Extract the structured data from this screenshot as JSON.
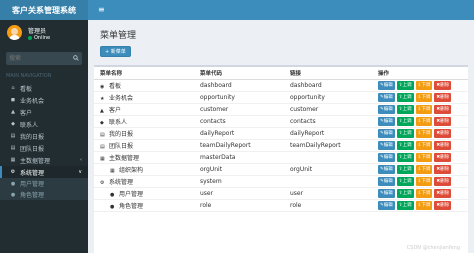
{
  "app": {
    "title": "客户关系管理系统",
    "menu_toggle": "≡"
  },
  "user": {
    "name": "管理员",
    "status": "Online"
  },
  "search": {
    "placeholder": "搜索"
  },
  "sidebar": {
    "header": "MAIN NAVIGATION",
    "items": [
      {
        "icon": "⌂",
        "label": "看板"
      },
      {
        "icon": "◼",
        "label": "业务机会"
      },
      {
        "icon": "▲",
        "label": "客户"
      },
      {
        "icon": "◆",
        "label": "联系人"
      },
      {
        "icon": "▤",
        "label": "我的日报"
      },
      {
        "icon": "▤",
        "label": "团队日报"
      },
      {
        "icon": "▦",
        "label": "主数据管理",
        "caret": "‹"
      },
      {
        "icon": "⚙",
        "label": "系统管理",
        "caret": "∨"
      }
    ],
    "subitems": [
      {
        "icon": "●",
        "label": "用户管理"
      },
      {
        "icon": "●",
        "label": "角色管理"
      }
    ]
  },
  "page": {
    "title": "菜单管理",
    "add_button": "+ 新菜单"
  },
  "table": {
    "headers": [
      "菜单名称",
      "菜单代码",
      "链接",
      "操作"
    ],
    "rows": [
      {
        "icon": "◉",
        "name": "看板",
        "code": "dashboard",
        "link": "dashboard"
      },
      {
        "icon": "★",
        "name": "业务机会",
        "code": "opportunity",
        "link": "opportunity"
      },
      {
        "icon": "▲",
        "name": "客户",
        "code": "customer",
        "link": "customer"
      },
      {
        "icon": "◆",
        "name": "联系人",
        "code": "contacts",
        "link": "contacts"
      },
      {
        "icon": "▤",
        "name": "我的日报",
        "code": "dailyReport",
        "link": "dailyReport"
      },
      {
        "icon": "▤",
        "name": "团队日报",
        "code": "teamDailyReport",
        "link": "teamDailyReport"
      },
      {
        "icon": "▦",
        "name": "主数据管理",
        "code": "masterData",
        "link": ""
      },
      {
        "icon": "▦",
        "name": "组织架构",
        "code": "orgUnit",
        "link": "orgUnit",
        "indent": true
      },
      {
        "icon": "⚙",
        "name": "系统管理",
        "code": "system",
        "link": ""
      },
      {
        "icon": "●",
        "name": "用户管理",
        "code": "user",
        "link": "user",
        "indent": true
      },
      {
        "icon": "●",
        "name": "角色管理",
        "code": "role",
        "link": "role",
        "indent": true
      }
    ],
    "actions": {
      "edit": "✎编辑",
      "up": "⇧上调",
      "down": "⇩下调",
      "delete": "✖删除"
    }
  },
  "watermark": "CSDN @chenjianfeng",
  "colors": {
    "primary": "#3c8dbc",
    "success": "#00a65a",
    "warning": "#f39c12",
    "danger": "#dd4b39",
    "sidebar": "#222d32"
  }
}
